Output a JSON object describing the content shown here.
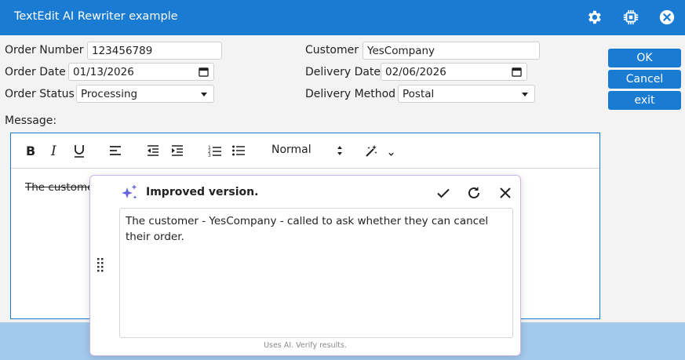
{
  "window": {
    "title": "TextEdit AI Rewriter example",
    "icons": [
      "gear-icon",
      "chip-icon",
      "close-circle-icon"
    ]
  },
  "form": {
    "order_number": {
      "label": "Order Number",
      "value": "123456789"
    },
    "order_date": {
      "label": "Order Date",
      "value": "01/13/2026"
    },
    "order_status": {
      "label": "Order Status",
      "value": "Processing"
    },
    "customer": {
      "label": "Customer",
      "value": "YesCompany"
    },
    "delivery_date": {
      "label": "Delivery Date",
      "value": "02/06/2026"
    },
    "delivery_method": {
      "label": "Delivery Method",
      "value": "Postal"
    },
    "message_label": "Message:"
  },
  "buttons": {
    "ok": "OK",
    "cancel": "Cancel",
    "exit": "exit"
  },
  "toolbar": {
    "items": [
      "bold-icon",
      "italic-icon",
      "underline-icon",
      "align-left-icon",
      "outdent-icon",
      "indent-icon",
      "ordered-list-icon",
      "bullet-list-icon",
      "magic-wand-icon"
    ],
    "format_select": "Normal"
  },
  "editor": {
    "visible_text": "The custome"
  },
  "ai_popup": {
    "heading": "Improved version.",
    "suggestion": "The customer - YesCompany - called to ask whether they can cancel their order.",
    "footnote": "Uses AI. Verify results.",
    "accent_color": "#6b4fd8"
  },
  "colors": {
    "primary": "#1a7bd3",
    "bottom_bar": "#a3c9ec"
  }
}
